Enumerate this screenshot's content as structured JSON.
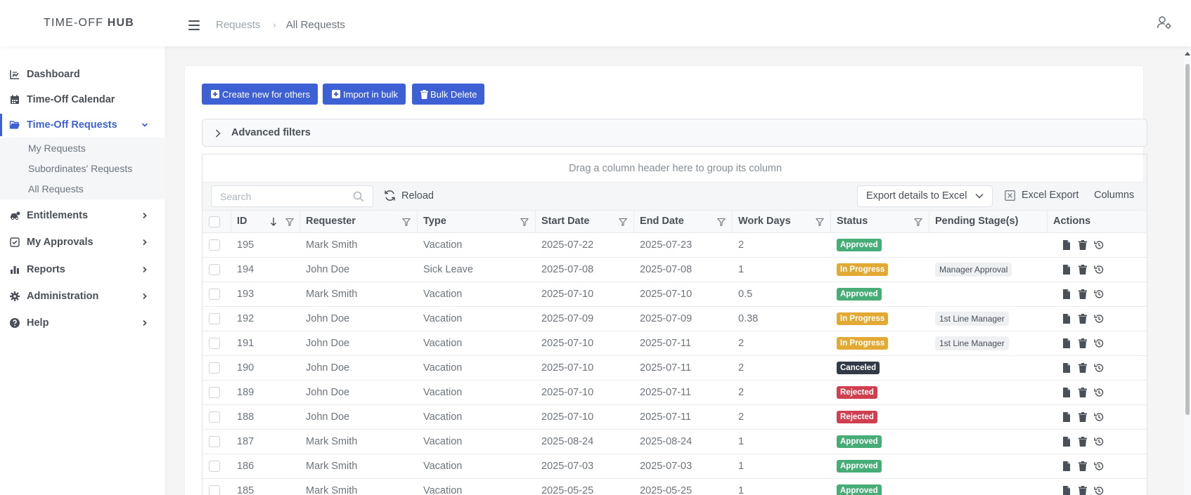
{
  "app": {
    "logo_light": "TIME-OFF",
    "logo_bold": "HUB"
  },
  "header": {
    "breadcrumb": [
      "Requests",
      "All Requests"
    ],
    "user_icon": "user-settings-icon"
  },
  "sidebar": {
    "items": [
      {
        "label": "Dashboard",
        "icon": "chart-line-icon",
        "has_chevron": false
      },
      {
        "label": "Time-Off Calendar",
        "icon": "calendar-icon",
        "has_chevron": false
      },
      {
        "label": "Time-Off Requests",
        "icon": "folder-open-icon",
        "has_chevron": true,
        "expanded": true,
        "active": true
      },
      {
        "label": "Entitlements",
        "icon": "car-icon",
        "has_chevron": true
      },
      {
        "label": "My Approvals",
        "icon": "check-square-icon",
        "has_chevron": true
      },
      {
        "label": "Reports",
        "icon": "bar-chart-icon",
        "has_chevron": true
      },
      {
        "label": "Administration",
        "icon": "gear-icon",
        "has_chevron": true
      },
      {
        "label": "Help",
        "icon": "question-circle-icon",
        "has_chevron": true
      }
    ],
    "subitems": [
      "My Requests",
      "Subordinates' Requests",
      "All Requests"
    ]
  },
  "actions": {
    "create": "Create new for others",
    "import": "Import in bulk",
    "bulk_delete": "Bulk Delete"
  },
  "filters": {
    "label": "Advanced filters"
  },
  "grid": {
    "group_panel": "Drag a column header here to group its column",
    "search_placeholder": "Search",
    "reload": "Reload",
    "export_select": "Export details to Excel",
    "excel_export": "Excel Export",
    "columns": "Columns",
    "headers": [
      "ID",
      "Requester",
      "Type",
      "Start Date",
      "End Date",
      "Work Days",
      "Status",
      "Pending Stage(s)",
      "Actions"
    ],
    "rows": [
      {
        "id": "195",
        "requester": "Mark Smith",
        "type": "Vacation",
        "start": "2025-07-22",
        "end": "2025-07-23",
        "days": "2",
        "status": "Approved",
        "stage": ""
      },
      {
        "id": "194",
        "requester": "John Doe",
        "type": "Sick Leave",
        "start": "2025-07-08",
        "end": "2025-07-08",
        "days": "1",
        "status": "In Progress",
        "stage": "Manager Approval"
      },
      {
        "id": "193",
        "requester": "Mark Smith",
        "type": "Vacation",
        "start": "2025-07-10",
        "end": "2025-07-10",
        "days": "0.5",
        "status": "Approved",
        "stage": ""
      },
      {
        "id": "192",
        "requester": "John Doe",
        "type": "Vacation",
        "start": "2025-07-09",
        "end": "2025-07-09",
        "days": "0.38",
        "status": "In Progress",
        "stage": "1st Line Manager"
      },
      {
        "id": "191",
        "requester": "John Doe",
        "type": "Vacation",
        "start": "2025-07-10",
        "end": "2025-07-11",
        "days": "2",
        "status": "In Progress",
        "stage": "1st Line Manager"
      },
      {
        "id": "190",
        "requester": "John Doe",
        "type": "Vacation",
        "start": "2025-07-10",
        "end": "2025-07-11",
        "days": "2",
        "status": "Canceled",
        "stage": ""
      },
      {
        "id": "189",
        "requester": "John Doe",
        "type": "Vacation",
        "start": "2025-07-10",
        "end": "2025-07-11",
        "days": "2",
        "status": "Rejected",
        "stage": ""
      },
      {
        "id": "188",
        "requester": "John Doe",
        "type": "Vacation",
        "start": "2025-07-10",
        "end": "2025-07-11",
        "days": "2",
        "status": "Rejected",
        "stage": ""
      },
      {
        "id": "187",
        "requester": "Mark Smith",
        "type": "Vacation",
        "start": "2025-08-24",
        "end": "2025-08-24",
        "days": "1",
        "status": "Approved",
        "stage": ""
      },
      {
        "id": "186",
        "requester": "Mark Smith",
        "type": "Vacation",
        "start": "2025-07-03",
        "end": "2025-07-03",
        "days": "1",
        "status": "Approved",
        "stage": ""
      },
      {
        "id": "185",
        "requester": "Mark Smith",
        "type": "Vacation",
        "start": "2025-05-25",
        "end": "2025-05-25",
        "days": "1",
        "status": "Approved",
        "stage": ""
      }
    ],
    "row_action_icons": [
      "file-icon",
      "trash-icon",
      "history-icon"
    ]
  },
  "colors": {
    "accent": "#3e60d5",
    "status": {
      "Approved": "#47ad77",
      "In Progress": "#e3a935",
      "Canceled": "#313a46",
      "Rejected": "#d03f4f"
    }
  }
}
